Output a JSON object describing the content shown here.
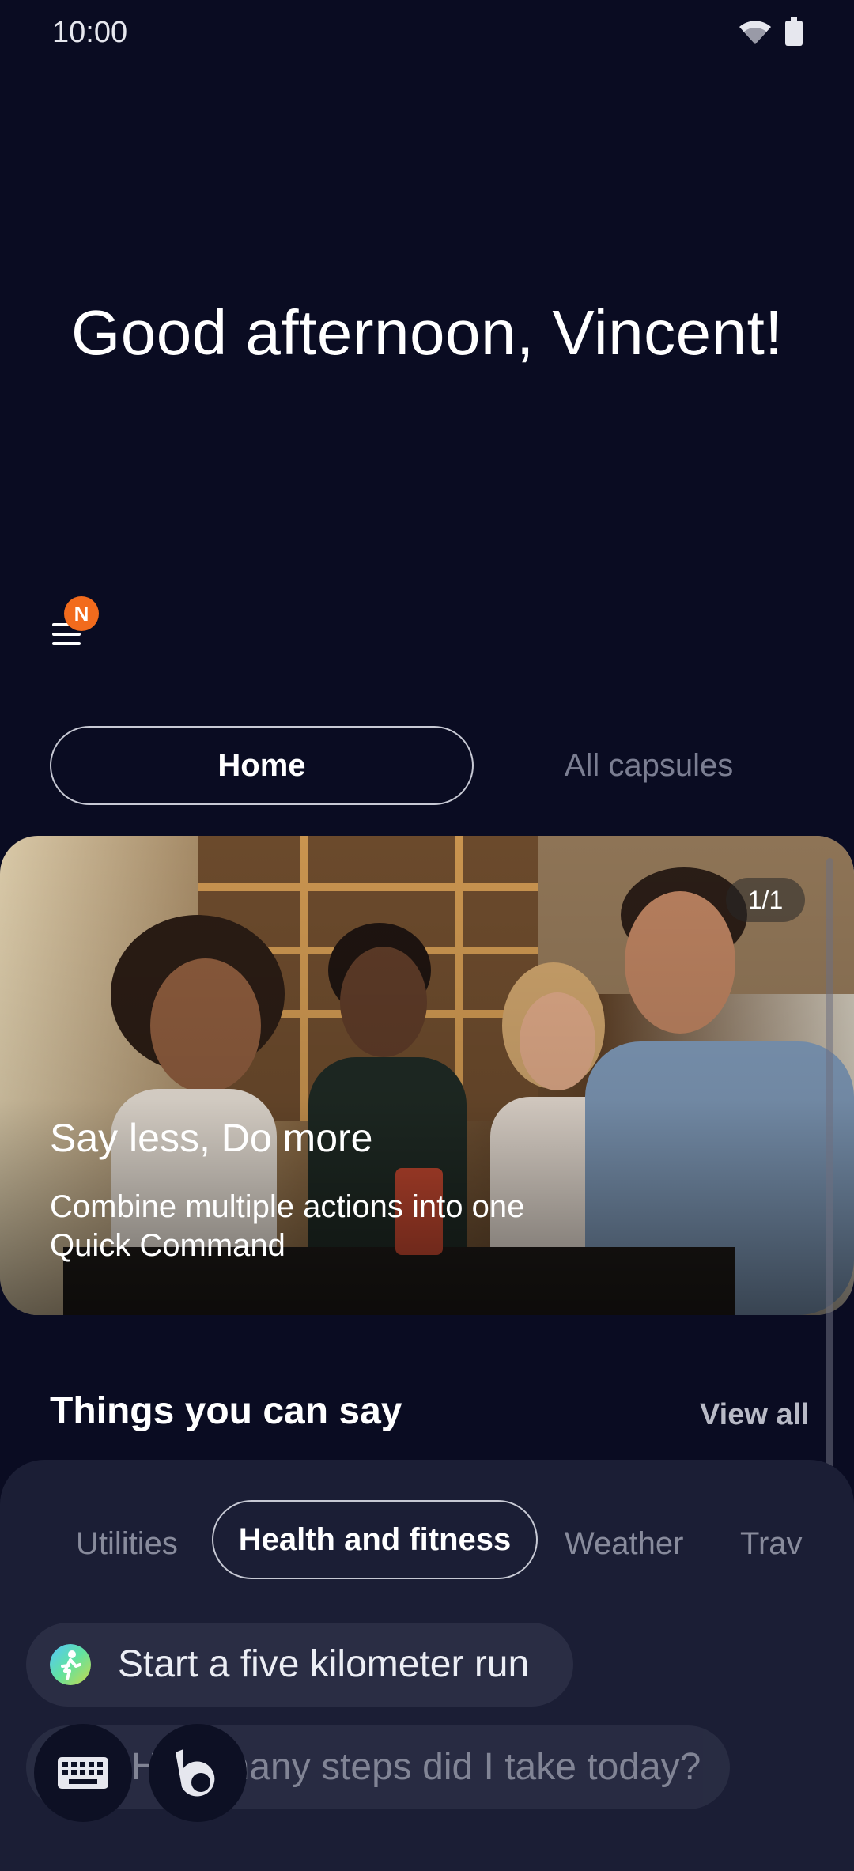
{
  "status_bar": {
    "time": "10:00"
  },
  "greeting": "Good afternoon, Vincent!",
  "menu": {
    "badge": "N"
  },
  "tabs": {
    "home": "Home",
    "all_capsules": "All capsules"
  },
  "hero": {
    "counter": "1/1",
    "title": "Say less, Do more",
    "subtitle": "Combine multiple actions into one Quick Command"
  },
  "things_section": {
    "title": "Things you can say",
    "view_all": "View all"
  },
  "categories": [
    "Utilities",
    "Health and fitness",
    "Weather",
    "Trav"
  ],
  "selected_category": "Health and fitness",
  "suggestions": [
    {
      "text": "Start a five kilometer run"
    },
    {
      "text": "How many steps did I take today?"
    }
  ],
  "colors": {
    "background": "#0a0c22",
    "badge": "#f26b1d",
    "panel": "#1b1e35"
  },
  "icons": [
    "wifi-icon",
    "battery-icon",
    "menu-icon",
    "keyboard-icon",
    "bixby-icon",
    "runner-icon"
  ]
}
